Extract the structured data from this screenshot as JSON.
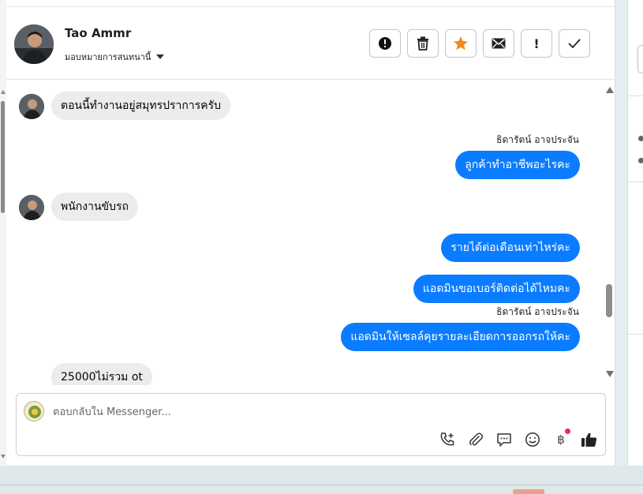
{
  "header": {
    "contact_name": "Tao Ammr",
    "assign_label": "มอบหมายการสนทนานี้",
    "actions": [
      {
        "icon": "alert-circle-icon"
      },
      {
        "icon": "trash-icon"
      },
      {
        "icon": "star-icon",
        "color": "#f08c1a"
      },
      {
        "icon": "mail-icon"
      },
      {
        "icon": "exclamation-icon",
        "label": "!"
      },
      {
        "icon": "check-icon"
      }
    ]
  },
  "messages": [
    {
      "direction": "in",
      "text": "ตอนนี้ทำงานอยู่สมุทรปราการครับ"
    },
    {
      "direction": "out",
      "sender": "ธิดารัตน์ อาจประจัน",
      "text": "ลูกค้าทำอาชีพอะไรคะ"
    },
    {
      "direction": "in",
      "text": "พนักงานขับรถ"
    },
    {
      "direction": "out",
      "text": "รายได้ต่อเดือนเท่าไหร่คะ"
    },
    {
      "direction": "out",
      "text": "แอดมินขอเบอร์ติดต่อได้ไหมคะ"
    },
    {
      "direction": "out",
      "sender": "ธิดารัตน์ อาจประจัน",
      "text": "แอดมินให้เซลล์คุยรายละเอียดการออกรถให้คะ"
    },
    {
      "direction": "in",
      "text": "25000ไม่รวม ot"
    }
  ],
  "composer": {
    "placeholder": "ตอบกลับใน Messenger...",
    "tools": [
      "phone-plus-icon",
      "paperclip-icon",
      "chat-bubble-icon",
      "smiley-icon",
      "baht-icon",
      "thumbs-up-icon"
    ],
    "baht_symbol": "฿"
  },
  "colors": {
    "outgoing_bubble": "#0a7cff",
    "incoming_bubble": "#ececec",
    "star": "#f08c1a",
    "notification_dot": "#f0284a"
  }
}
